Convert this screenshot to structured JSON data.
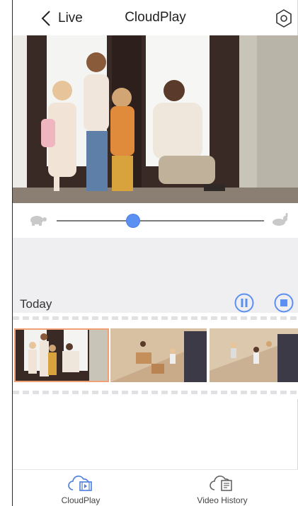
{
  "header": {
    "back_label": "Live",
    "title": "CloudPlay",
    "settings_icon": "gear-icon"
  },
  "speed": {
    "slow_icon": "turtle-icon",
    "fast_icon": "rabbit-icon",
    "level": 0.37,
    "accent": "#5b8ff1"
  },
  "timeline": {
    "section_label": "Today",
    "pause_icon": "pause-icon",
    "stop_icon": "stop-icon",
    "thumbnails": [
      {
        "scene": "family-at-door",
        "selected": true
      },
      {
        "scene": "living-room-overhead-1",
        "selected": false
      },
      {
        "scene": "living-room-overhead-2",
        "selected": false
      }
    ],
    "selected_color": "#f0a073"
  },
  "tabs": [
    {
      "label": "CloudPlay",
      "icon": "cloud-film-icon"
    },
    {
      "label": "Video History",
      "icon": "cloud-history-icon"
    }
  ]
}
